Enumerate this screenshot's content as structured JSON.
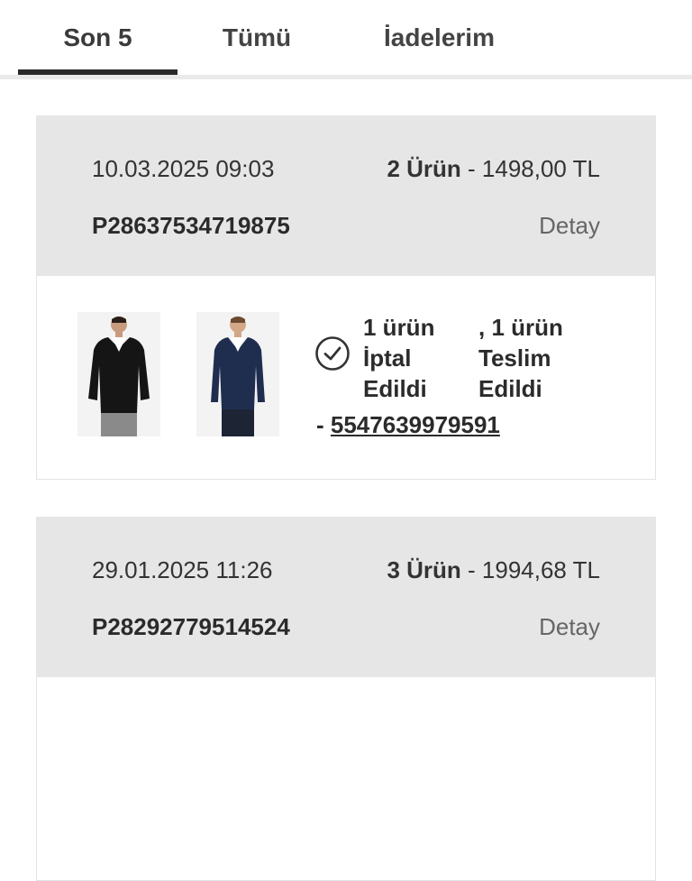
{
  "tabs": [
    {
      "label": "Son 5",
      "active": true
    },
    {
      "label": "Tümü",
      "active": false
    },
    {
      "label": "İadelerim",
      "active": false
    }
  ],
  "orders": [
    {
      "date": "10.03.2025 09:03",
      "item_count": "2 Ürün",
      "separator": " - ",
      "total": "1498,00 TL",
      "order_no": "P28637534719875",
      "detail_label": "Detay",
      "products": [
        {
          "name": "black-v-neck-sweater",
          "color": "#1a1a1a"
        },
        {
          "name": "navy-v-neck-sweater",
          "color": "#1f2d4f"
        }
      ],
      "status_icon": "check-circle-icon",
      "status_line1": "1 ürün İptal Edildi",
      "status_line2": ", 1 ürün Teslim Edildi",
      "tracking_prefix": "- ",
      "tracking_no": "5547639979591"
    },
    {
      "date": "29.01.2025 11:26",
      "item_count": "3 Ürün",
      "separator": " - ",
      "total": "1994,68 TL",
      "order_no": "P28292779514524",
      "detail_label": "Detay"
    }
  ]
}
